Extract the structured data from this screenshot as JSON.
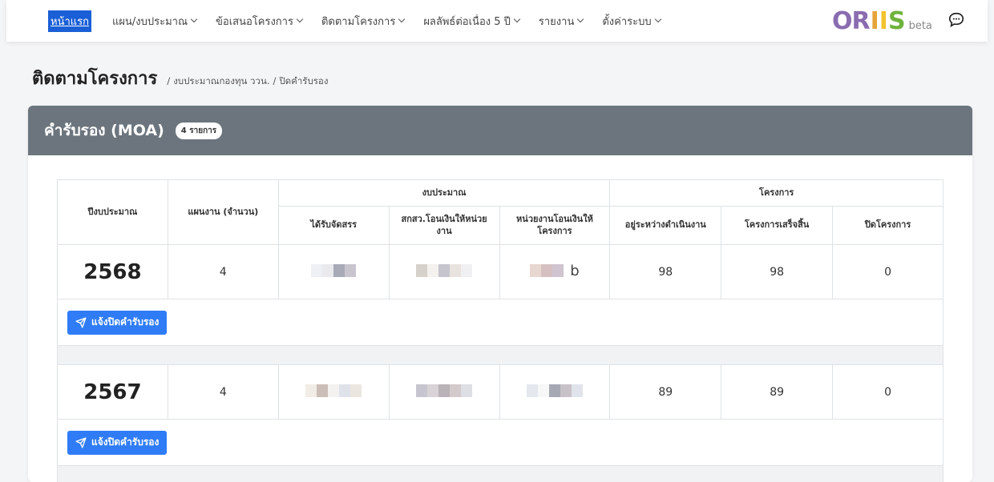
{
  "nav": {
    "items": [
      {
        "label": "หน้าแรก",
        "active": true,
        "dropdown": false
      },
      {
        "label": "แผน/งบประมาณ",
        "active": false,
        "dropdown": true
      },
      {
        "label": "ข้อเสนอโครงการ",
        "active": false,
        "dropdown": true
      },
      {
        "label": "ติดตามโครงการ",
        "active": false,
        "dropdown": true
      },
      {
        "label": "ผลลัพธ์ต่อเนื่อง 5 ปี",
        "active": false,
        "dropdown": true
      },
      {
        "label": "รายงาน",
        "active": false,
        "dropdown": true
      },
      {
        "label": "ตั้งค่าระบบ",
        "active": false,
        "dropdown": true
      }
    ],
    "brand_main": "ORIIS",
    "brand_beta": "beta"
  },
  "page": {
    "title": "ติดตามโครงการ",
    "breadcrumb": [
      "งบประมาณกองทุน ววน.",
      "ปิดคำรับรอง"
    ]
  },
  "card": {
    "title": "คำรับรอง (MOA)",
    "count_badge": "4 รายการ"
  },
  "table": {
    "headers": {
      "year": "ปีงบประมาณ",
      "plans": "แผนงาน (จำนวน)",
      "budget_group": "งบประมาณ",
      "project_group": "โครงการ",
      "allocated": "ได้รับจัดสรร",
      "transfer_unit": "สกสว.โอนเงินให้หน่วยงาน",
      "transfer_project": "หน่วยงานโอนเงินให้โครงการ",
      "in_progress": "อยู่ระหว่างดำเนินงาน",
      "completed": "โครงการเสร็จสิ้น",
      "closed": "ปิดโครงการ"
    },
    "rows": [
      {
        "year": "2568",
        "plans": "4",
        "in_progress": "98",
        "completed": "98",
        "closed": "0",
        "trail": "b"
      },
      {
        "year": "2567",
        "plans": "4",
        "in_progress": "89",
        "completed": "89",
        "closed": "0",
        "trail": ""
      }
    ],
    "action_label": "แจ้งปิดคำรับรอง"
  },
  "colors": {
    "nav_active": "#1a5fd6",
    "card_header": "#6c757d",
    "button": "#2f7cf6"
  },
  "icons": [
    "chevron-down-icon",
    "chat-icon",
    "send-icon"
  ]
}
